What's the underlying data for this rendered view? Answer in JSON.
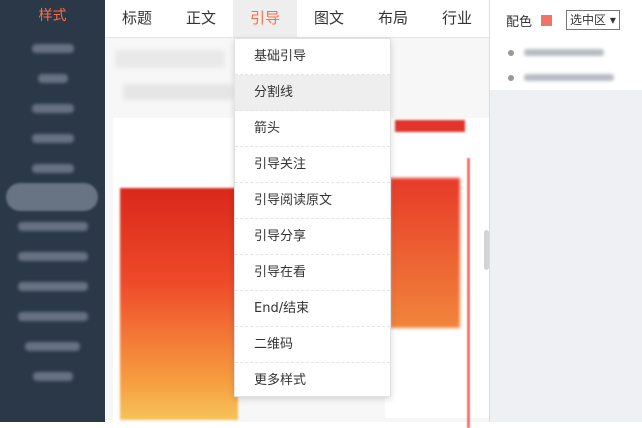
{
  "sidebar": {
    "title": "样式",
    "items": [
      "",
      "",
      "",
      "",
      "",
      "",
      "",
      "",
      "",
      "",
      "",
      "",
      ""
    ]
  },
  "tabs": [
    {
      "label": "标题"
    },
    {
      "label": "正文"
    },
    {
      "label": "引导",
      "active": true
    },
    {
      "label": "图文"
    },
    {
      "label": "布局"
    },
    {
      "label": "行业"
    }
  ],
  "color_panel": {
    "label": "配色",
    "swatch": "#f07369",
    "select_value": "选中区"
  },
  "dropdown": {
    "items": [
      "基础引导",
      "分割线",
      "箭头",
      "引导关注",
      "引导阅读原文",
      "引导分享",
      "引导在看",
      "End/结束",
      "二维码",
      "更多样式"
    ],
    "hover_index": 1
  },
  "colors": {
    "accent": "#ff6c43",
    "sidebar_bg": "#2b3848"
  }
}
